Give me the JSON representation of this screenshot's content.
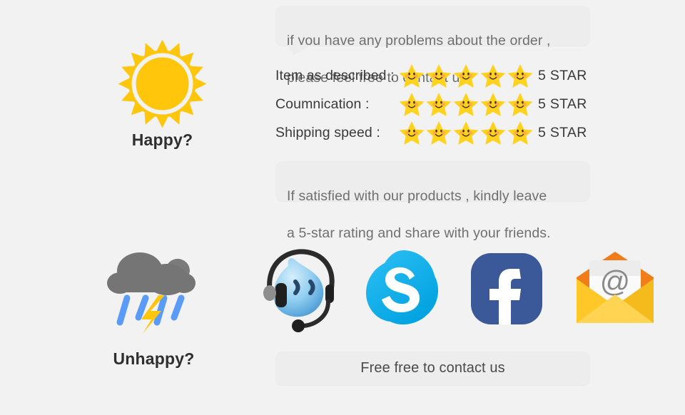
{
  "page": {
    "background_color": "#f2f2f2",
    "text_color": "#3a3a3a",
    "bubble_color": "#ededed",
    "bubble_text_color": "#6f6f6f"
  },
  "bubbles": {
    "top": {
      "line1": "if you have any problems about the order ,",
      "line2": "please feel free to contact us."
    },
    "bottom": {
      "line1": "If satisfied with our products , kindly leave",
      "line2": "a 5-star rating and share with your friends."
    }
  },
  "ratings": {
    "rows": [
      {
        "label": "Item as described :",
        "stars": 5,
        "value": "5 STAR"
      },
      {
        "label": "Coumnication :",
        "stars": 5,
        "value": "5 STAR"
      },
      {
        "label": "Shipping speed :",
        "stars": 5,
        "value": "5 STAR"
      }
    ],
    "star_color": "#ffd21e",
    "star_face_color": "#f59c1a"
  },
  "moods": {
    "happy": {
      "label": "Happy?",
      "icon": "sun-icon",
      "color": "#ffc60b"
    },
    "unhappy": {
      "label": "Unhappy?",
      "icon": "rain-cloud-icon",
      "cloud_color": "#757575",
      "rain_color": "#5b9bf8",
      "bolt_color": "#ffc60b"
    }
  },
  "contact": {
    "button_label": "Free free to contact us",
    "icons": [
      {
        "name": "trademanager-icon",
        "title": "TradeManager",
        "color": "#5fa9e0"
      },
      {
        "name": "skype-icon",
        "title": "Skype",
        "color": "#00aff0"
      },
      {
        "name": "facebook-icon",
        "title": "Facebook",
        "color": "#3b5998"
      },
      {
        "name": "email-icon",
        "title": "Email",
        "color": "#ffc828"
      }
    ]
  }
}
